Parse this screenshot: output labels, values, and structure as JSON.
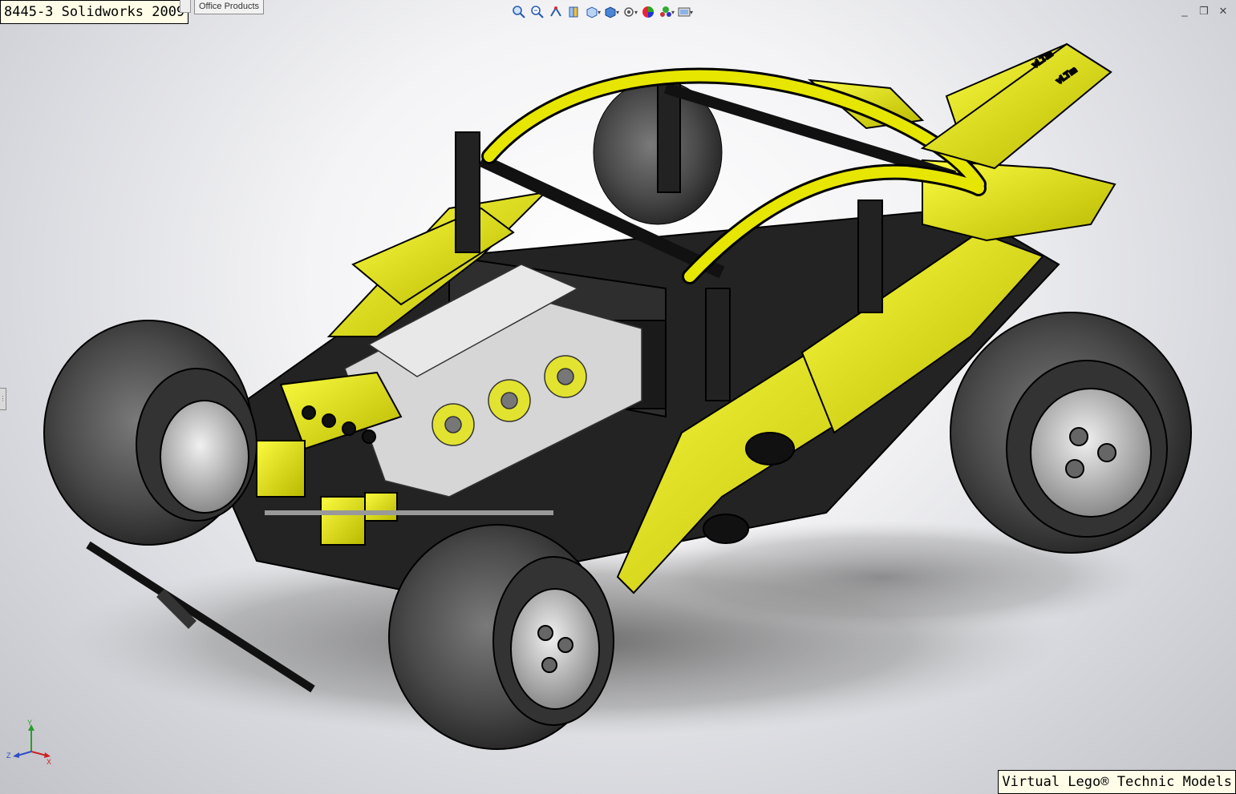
{
  "title_label": "8445-3 Solidworks 2009",
  "tabs": [
    "Office Products"
  ],
  "credit_label": "Virtual Lego® Technic Models",
  "hud_icons": [
    "zoom-to-fit-icon",
    "zoom-area-icon",
    "previous-view-icon",
    "section-view-icon",
    "view-orientation-icon",
    "display-style-icon",
    "hide-show-items-icon",
    "edit-appearance-icon",
    "apply-scene-icon",
    "view-settings-icon"
  ],
  "triad_axes": [
    "Y",
    "X",
    "Z"
  ],
  "model_decal_text": "vLTm",
  "colors": {
    "body_yellow": "#e6e600",
    "body_black": "#1c1c1c",
    "tire_gray": "#4a4a4a",
    "rim_gray": "#c8c8c8",
    "engine_clear": "#dcdcdc",
    "label_bg": "#fffde8"
  }
}
